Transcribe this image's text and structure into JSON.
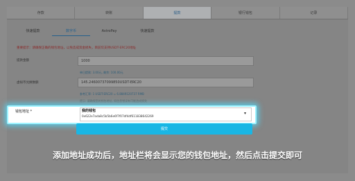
{
  "tabs": [
    "存款",
    "转账",
    "提款",
    "银行钱包",
    "记录"
  ],
  "subtabs": [
    "快速提款",
    "数字币",
    "AstroPay",
    "快速提款"
  ],
  "warning": "重要提示：请确保正确的钱包地址，以免造成资金损失，目前仅支持USDT-ERC20地址",
  "amount": {
    "label": "提款金额",
    "value": "1000"
  },
  "daily_info": "单日提款: 3.00元, 剩余: 100.00元",
  "estimate": {
    "label": "虚拟币兑换数额",
    "value": "145.24600737099850USDT-ERC20"
  },
  "rate_info": "参考汇率: 1 USDT-ERC20 = 6.8849120737 RMB",
  "note": "提示: 请确保您的钱包地址, 如信息错误有可能造成损失",
  "wallet": {
    "label": "钱包地址 *",
    "name": "我的钱包",
    "address": "0x622e7ada8c5b5b6e6f7f07df4df611838642269"
  },
  "submit_label": "提交",
  "caption": "添加地址成功后，地址栏将会显示您的钱包地址，然后点击提交即可"
}
